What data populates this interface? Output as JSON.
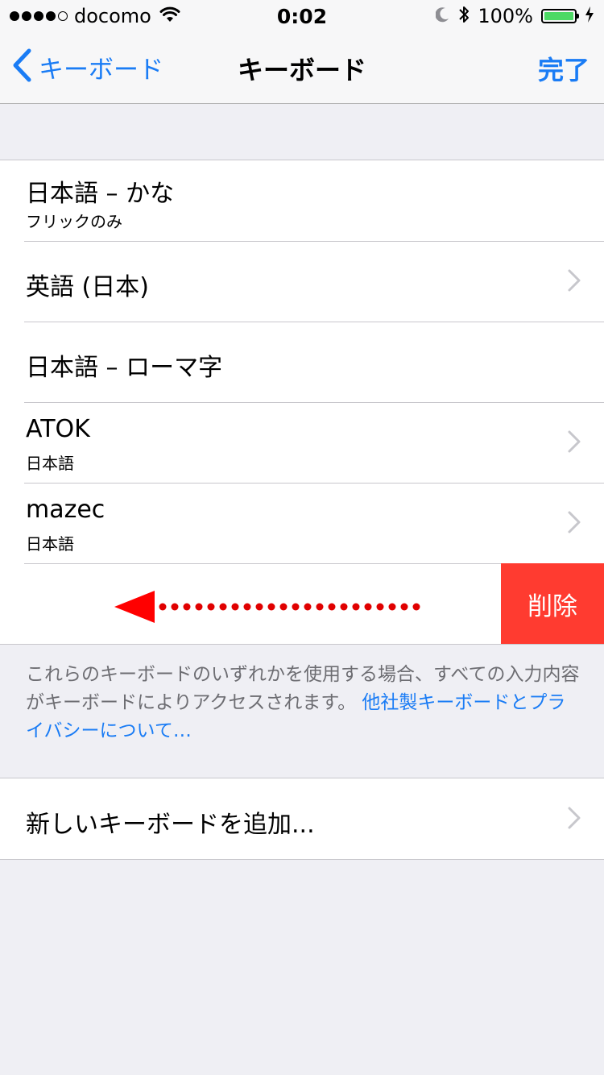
{
  "status_bar": {
    "carrier": "docomo",
    "time": "0:02",
    "battery_percent": "100%",
    "battery_level": 1.0,
    "signal_bars": 4,
    "signal_total": 5
  },
  "nav": {
    "back_label": "キーボード",
    "title": "キーボード",
    "done_label": "完了"
  },
  "keyboards": [
    {
      "title": "日本語 – かな",
      "subtitle": "フリックのみ"
    },
    {
      "title": "英語 (日本)"
    },
    {
      "title": "日本語 – ローマ字"
    },
    {
      "title": "ATOK",
      "subtitle": "日本語"
    },
    {
      "title": "mazec",
      "subtitle": "日本語"
    }
  ],
  "swipe_row": {
    "delete_label": "削除",
    "arrow_color": "#ff0000"
  },
  "footer": {
    "text": "これらのキーボードのいずれかを使用する場合、すべての入力内容がキーボードによりアクセスされます。",
    "link": "他社製キーボードとプライバシーについて…"
  },
  "add_keyboard": {
    "label": "新しいキーボードを追加..."
  },
  "colors": {
    "accent": "#1a7cf5",
    "delete": "#ff3b30",
    "background": "#efeff4",
    "battery": "#4cd964"
  }
}
